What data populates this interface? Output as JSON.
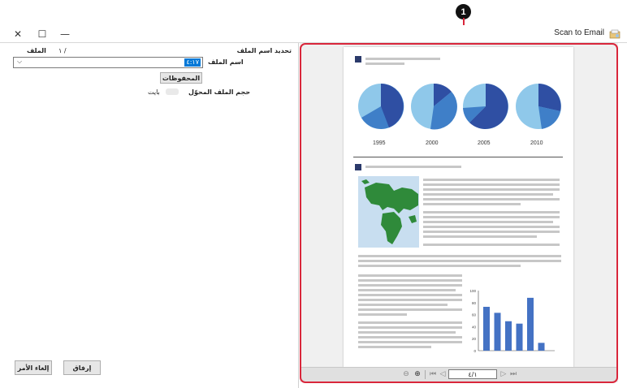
{
  "window": {
    "title": "Scan to Email",
    "close_glyph": "✕",
    "maximize_glyph": "☐",
    "minimize_glyph": "—"
  },
  "form": {
    "naming_label": "تحديد اسم الملف",
    "page_counter": "١ /",
    "file_label": "الملف",
    "file_name_label": "اسم الملف",
    "file_name_value": "٤:١٧",
    "stored_button": "المحفوظات",
    "size_label": "حجم الملف المحوّل",
    "size_unit": "بايت"
  },
  "actions": {
    "attach_button": "إرفاق",
    "cancel_button": "إلغاء الأمر"
  },
  "callout": {
    "number": "1"
  },
  "preview": {
    "page_indicator": "٤/١",
    "years": [
      "1995",
      "2000",
      "2005",
      "2010"
    ]
  },
  "colors": {
    "accent_red": "#d9263b",
    "pie_dark": "#2f4fa3",
    "pie_mid": "#3f7fc8",
    "pie_light": "#8fc8ea",
    "bar_blue": "#4472c4"
  },
  "chart_data": {
    "type": "bar",
    "y_ticks": [
      "100",
      "80",
      "60",
      "40",
      "20",
      "0"
    ],
    "ylim": [
      0,
      100
    ],
    "values": [
      73,
      63,
      49,
      45,
      88,
      13
    ]
  }
}
